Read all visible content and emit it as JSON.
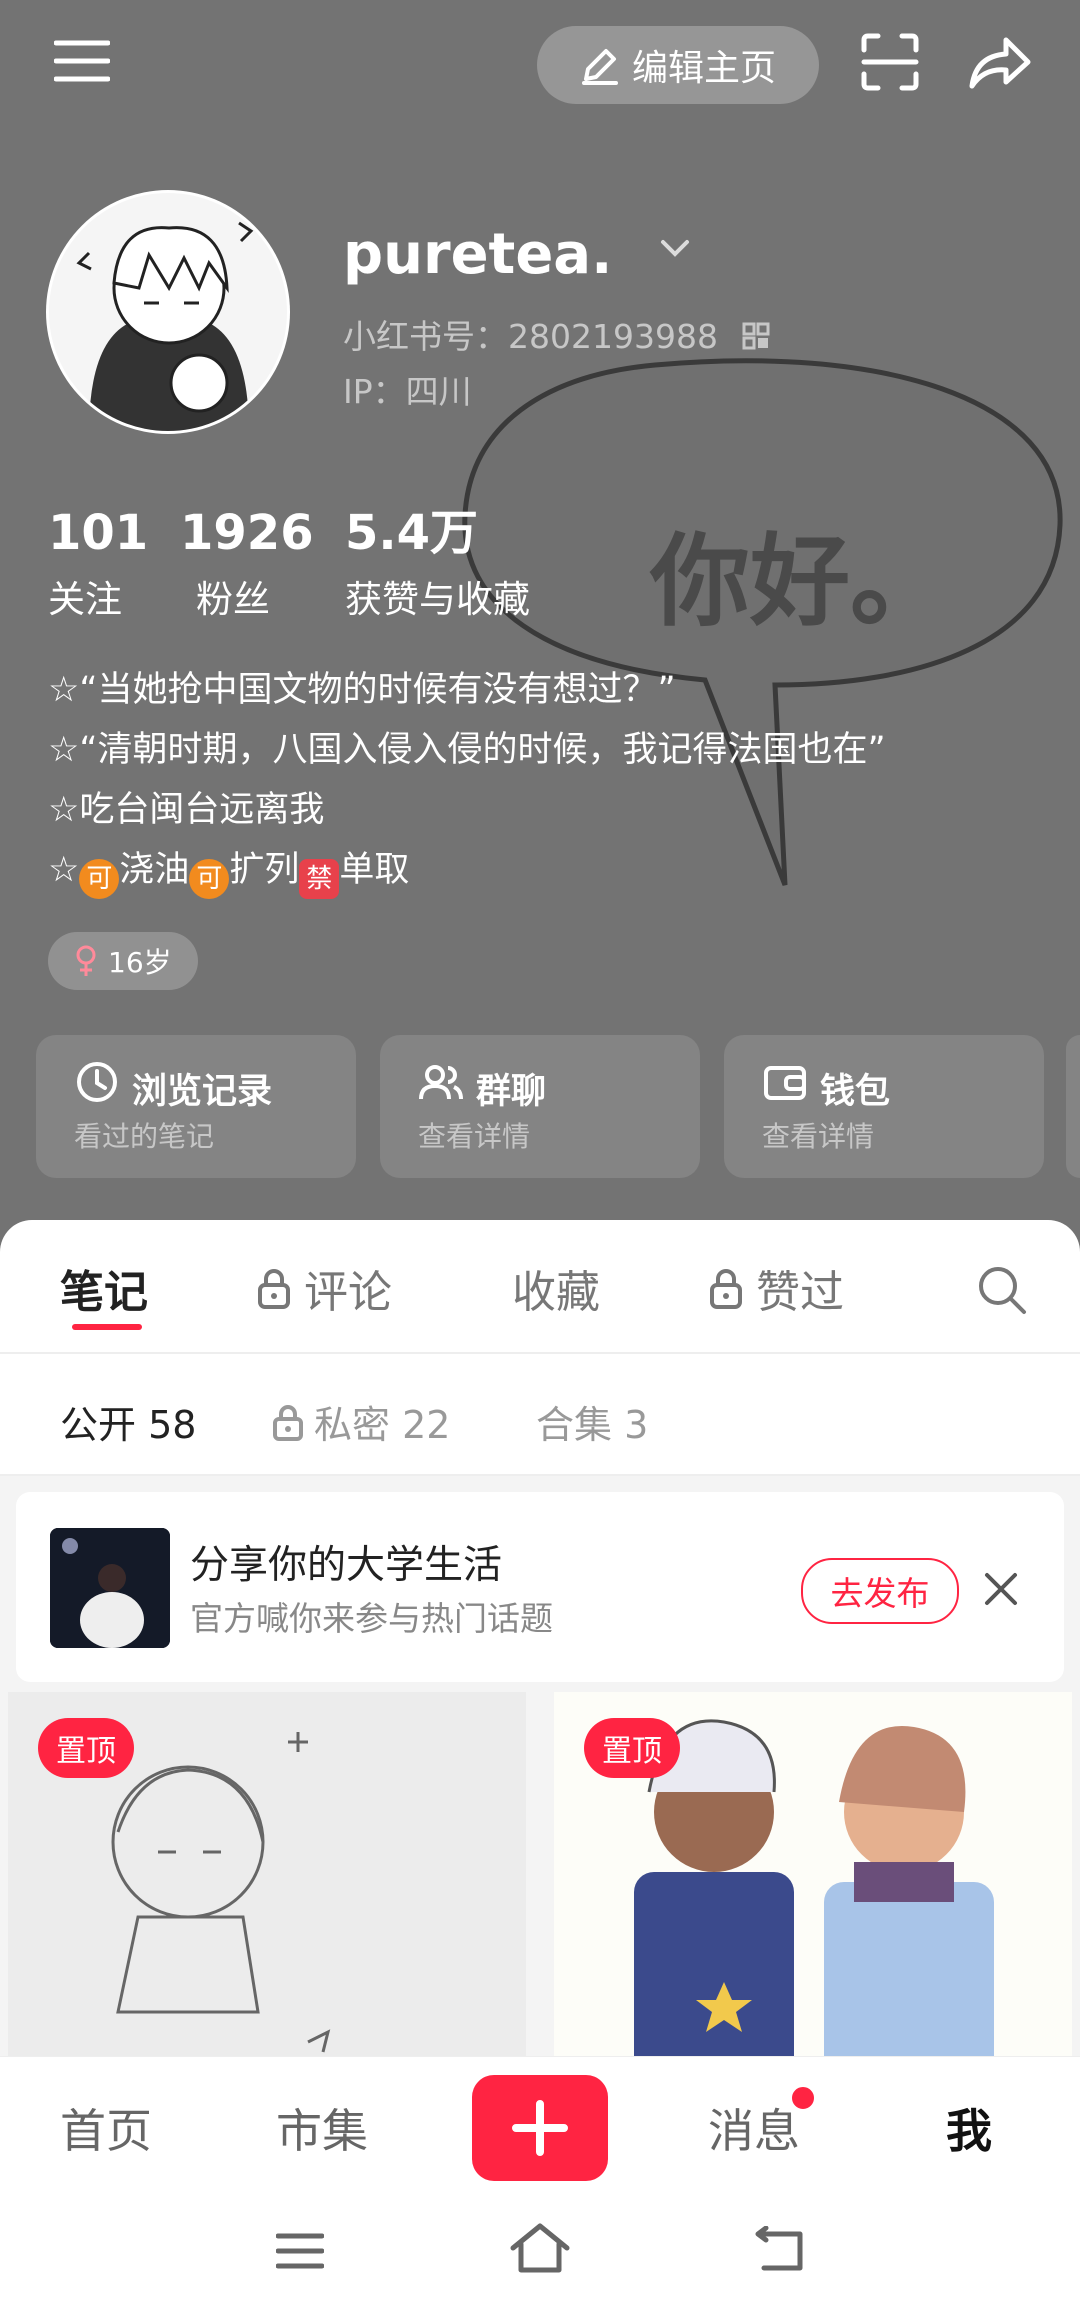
{
  "profile": {
    "username": "puretea.",
    "id_label": "小红书号：2802193988",
    "ip_label": "IP：四川",
    "background_text": "你好。",
    "stats": [
      {
        "num": "101",
        "label": "关注"
      },
      {
        "num": "1926",
        "label": "粉丝"
      },
      {
        "num": "5.4万",
        "label": "获赞与收藏"
      }
    ],
    "bio": [
      "☆“当她抢中国文物的时候有没有想过？”",
      "☆“清朝时期，八国入侵入侵的时候，我记得法国也在”",
      "☆吃台闽台远离我"
    ],
    "bio_line4": {
      "star": "☆",
      "e1": "可",
      "t1": "浇油",
      "e2": "可",
      "t2": "扩列",
      "e3": "禁",
      "t3": "单取"
    },
    "age": "16岁"
  },
  "header": {
    "edit_label": "编辑主页"
  },
  "cards": [
    {
      "title": "浏览记录",
      "sub": "看过的笔记",
      "icon": "clock-icon"
    },
    {
      "title": "群聊",
      "sub": "查看详情",
      "icon": "group-icon"
    },
    {
      "title": "钱包",
      "sub": "查看详情",
      "icon": "wallet-icon"
    }
  ],
  "tabs": [
    {
      "label": "笔记",
      "active": true
    },
    {
      "label": "评论",
      "locked": true
    },
    {
      "label": "收藏"
    },
    {
      "label": "赞过",
      "locked": true
    }
  ],
  "subtabs": [
    {
      "label": "公开 58",
      "active": true
    },
    {
      "label": "私密 22",
      "locked": true
    },
    {
      "label": "合集 3"
    }
  ],
  "banner": {
    "title": "分享你的大学生活",
    "sub": "官方喊你来参与热门话题",
    "button": "去发布"
  },
  "posts": [
    {
      "pin": "置顶"
    },
    {
      "pin": "置顶"
    }
  ],
  "bottom_nav": [
    {
      "label": "首页"
    },
    {
      "label": "市集"
    },
    {
      "label": "消息"
    },
    {
      "label": "我",
      "active": true
    }
  ],
  "colors": {
    "accent": "#ff2442",
    "header_bg": "#737373"
  }
}
